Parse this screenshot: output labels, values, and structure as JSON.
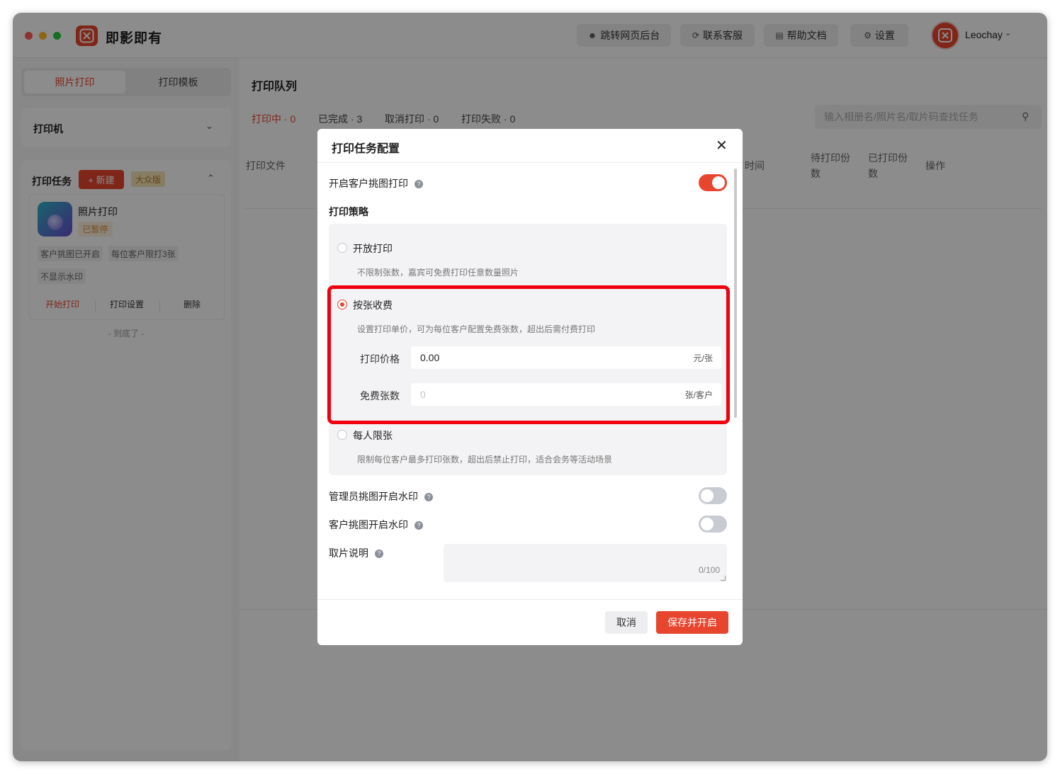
{
  "app": {
    "title": "即影即有"
  },
  "toolbar": {
    "jump_label": "跳转网页后台",
    "support_label": "联系客服",
    "help_label": "帮助文档",
    "settings_label": "设置"
  },
  "user": {
    "name": "Leochay"
  },
  "sidebar": {
    "tabs": [
      {
        "label": "照片打印",
        "active": true
      },
      {
        "label": "打印模板",
        "active": false
      }
    ],
    "printer_title": "打印机",
    "tasks_title": "打印任务",
    "new_button": "+ 新建",
    "edition_badge": "大众版",
    "task_card": {
      "name": "照片打印",
      "status": "已暂停",
      "tags": [
        "客户挑图已开启",
        "每位客户限打3张",
        "不显示水印"
      ],
      "actions": {
        "start": "开始打印",
        "settings": "打印设置",
        "delete": "删除"
      }
    },
    "end_text": "- 到底了 -"
  },
  "main": {
    "title": "打印队列",
    "tabs": [
      "打印中 · 0",
      "已完成 · 3",
      "取消打印 · 0",
      "打印失败 · 0"
    ],
    "search_placeholder": "输入相册名/照片名/取片码查找任务",
    "columns": {
      "file": "打印文件",
      "time": "时间",
      "pending_1": "待打印份",
      "pending_2": "数",
      "printed_1": "已打印份",
      "printed_2": "数",
      "ops": "操作"
    }
  },
  "modal": {
    "title": "打印任务配置",
    "customer_pick_label": "开启客户挑图打印",
    "customer_pick_on": true,
    "strategy_label": "打印策略",
    "options": [
      {
        "name": "开放打印",
        "desc": "不限制张数，嘉宾可免费打印任意数量照片",
        "selected": false
      },
      {
        "name": "按张收费",
        "desc": "设置打印单价，可为每位客户配置免费张数，超出后需付费打印",
        "selected": true
      },
      {
        "name": "每人限张",
        "desc": "限制每位客户最多打印张数，超出后禁止打印，适合会务等活动场景",
        "selected": false
      }
    ],
    "price": {
      "label": "打印价格",
      "value": "0.00",
      "unit": "元/张"
    },
    "free": {
      "label": "免费张数",
      "placeholder": "0",
      "unit": "张/客户"
    },
    "admin_watermark_label": "管理员挑图开启水印",
    "admin_watermark_on": false,
    "customer_watermark_label": "客户挑图开启水印",
    "customer_watermark_on": false,
    "pickup_note_label": "取片说明",
    "pickup_note_counter": "0/100",
    "cancel_label": "取消",
    "save_label": "保存并开启"
  },
  "colors": {
    "accent": "#e8452f",
    "highlight": "#f0000f"
  }
}
